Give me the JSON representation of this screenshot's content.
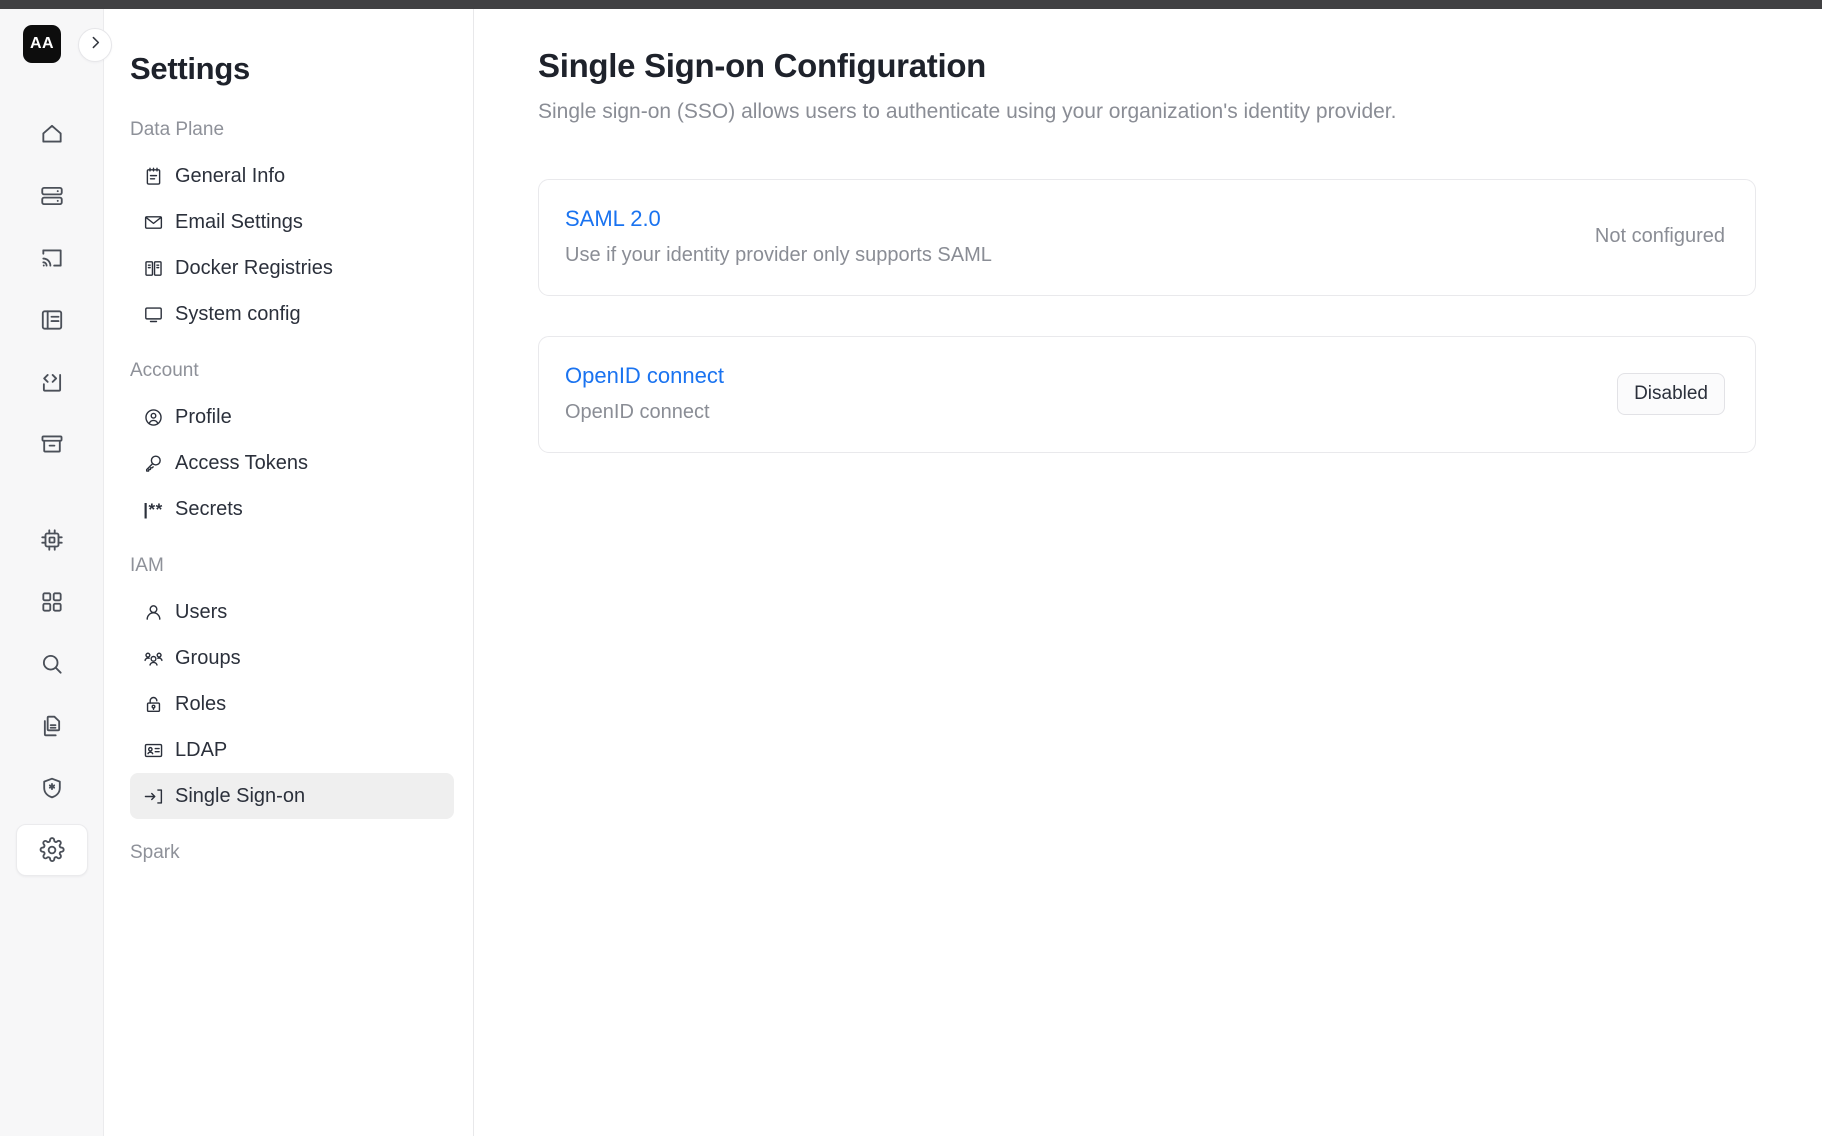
{
  "brand": {
    "logo_text": "AA"
  },
  "rail": {
    "items": [
      {
        "icon": "home-icon",
        "name": "rail-item-home"
      },
      {
        "icon": "server-icon",
        "name": "rail-item-clusters"
      },
      {
        "icon": "cast-icon",
        "name": "rail-item-streaming"
      },
      {
        "icon": "notebook-icon",
        "name": "rail-item-notebooks"
      },
      {
        "icon": "code-icon",
        "name": "rail-item-code"
      },
      {
        "icon": "archive-icon",
        "name": "rail-item-archive"
      },
      {
        "icon": "cpu-icon",
        "name": "rail-item-compute"
      },
      {
        "icon": "grid-icon",
        "name": "rail-item-apps"
      },
      {
        "icon": "search-icon",
        "name": "rail-item-search"
      },
      {
        "icon": "documents-icon",
        "name": "rail-item-documents"
      },
      {
        "icon": "shield-star-icon",
        "name": "rail-item-security"
      },
      {
        "icon": "gear-icon",
        "name": "rail-item-settings",
        "selected": true
      }
    ]
  },
  "sidebar": {
    "title": "Settings",
    "sections": [
      {
        "label": "Data Plane",
        "items": [
          {
            "label": "General Info",
            "icon": "notepad-icon"
          },
          {
            "label": "Email Settings",
            "icon": "mail-icon"
          },
          {
            "label": "Docker Registries",
            "icon": "registry-icon"
          },
          {
            "label": "System config",
            "icon": "monitor-icon"
          }
        ]
      },
      {
        "label": "Account",
        "items": [
          {
            "label": "Profile",
            "icon": "user-circle-icon"
          },
          {
            "label": "Access Tokens",
            "icon": "key-icon"
          },
          {
            "label": "Secrets",
            "icon": "asterisks-icon"
          }
        ]
      },
      {
        "label": "IAM",
        "items": [
          {
            "label": "Users",
            "icon": "user-icon"
          },
          {
            "label": "Groups",
            "icon": "users-icon"
          },
          {
            "label": "Roles",
            "icon": "lock-icon"
          },
          {
            "label": "LDAP",
            "icon": "id-card-icon"
          },
          {
            "label": "Single Sign-on",
            "icon": "sign-in-icon",
            "selected": true
          }
        ]
      },
      {
        "label": "Spark",
        "items": []
      }
    ]
  },
  "main": {
    "title": "Single Sign-on Configuration",
    "subtitle": "Single sign-on (SSO) allows users to authenticate using your organization's identity provider.",
    "cards": [
      {
        "link": "SAML 2.0",
        "description": "Use if your identity provider only supports SAML",
        "status_text": "Not configured",
        "action": null
      },
      {
        "link": "OpenID connect",
        "description": "OpenID connect",
        "status_text": null,
        "action": "Disabled"
      }
    ]
  },
  "colors": {
    "accent_link": "#1a73f0",
    "logo_bg": "#0d0d0d",
    "muted_text": "#8a8d95",
    "selected_nav_bg": "#efefef",
    "topbar": "#414143"
  }
}
